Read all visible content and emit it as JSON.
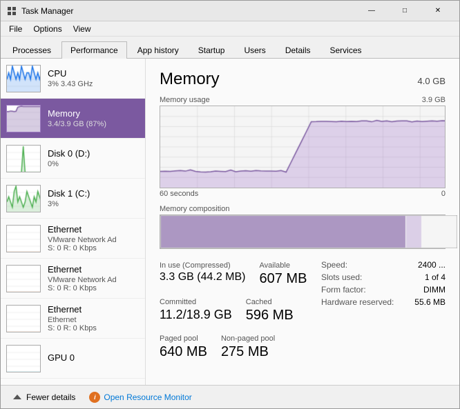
{
  "window": {
    "title": "Task Manager",
    "controls": {
      "minimize": "—",
      "maximize": "□",
      "close": "✕"
    }
  },
  "menu": {
    "items": [
      "File",
      "Options",
      "View"
    ]
  },
  "tabs": {
    "items": [
      "Processes",
      "Performance",
      "App history",
      "Startup",
      "Users",
      "Details",
      "Services"
    ],
    "active": "Performance"
  },
  "sidebar": {
    "items": [
      {
        "name": "CPU",
        "secondary": "3% 3.43 GHz",
        "type": "cpu"
      },
      {
        "name": "Memory",
        "secondary": "3.4/3.9 GB (87%)",
        "type": "memory",
        "selected": true
      },
      {
        "name": "Disk 0 (D:)",
        "secondary": "0%",
        "type": "disk0"
      },
      {
        "name": "Disk 1 (C:)",
        "secondary": "3%",
        "type": "disk1"
      },
      {
        "name": "Ethernet",
        "secondary_line1": "VMware Network Ad",
        "secondary_line2": "S: 0 R: 0 Kbps",
        "type": "eth1"
      },
      {
        "name": "Ethernet",
        "secondary_line1": "VMware Network Ad",
        "secondary_line2": "S: 0 R: 0 Kbps",
        "type": "eth2"
      },
      {
        "name": "Ethernet",
        "secondary_line1": "Ethernet",
        "secondary_line2": "S: 0 R: 0 Kbps",
        "type": "eth3"
      },
      {
        "name": "GPU 0",
        "secondary": "",
        "type": "gpu"
      }
    ],
    "scroll_up_label": "▲",
    "scroll_down_label": "▼"
  },
  "main": {
    "title": "Memory",
    "total": "4.0 GB",
    "chart": {
      "label": "Memory usage",
      "max_label": "3.9 GB",
      "time_start": "60 seconds",
      "time_end": "0",
      "composition_label": "Memory composition"
    },
    "stats": {
      "in_use_label": "In use (Compressed)",
      "in_use_value": "3.3 GB (44.2 MB)",
      "available_label": "Available",
      "available_value": "607 MB",
      "committed_label": "Committed",
      "committed_value": "11.2/18.9 GB",
      "cached_label": "Cached",
      "cached_value": "596 MB",
      "paged_pool_label": "Paged pool",
      "paged_pool_value": "640 MB",
      "non_paged_pool_label": "Non-paged pool",
      "non_paged_pool_value": "275 MB"
    },
    "right_stats": {
      "speed_label": "Speed:",
      "speed_value": "2400 ...",
      "slots_label": "Slots used:",
      "slots_value": "1 of 4",
      "form_label": "Form factor:",
      "form_value": "DIMM",
      "hardware_label": "Hardware reserved:",
      "hardware_value": "55.6 MB"
    }
  },
  "bottom": {
    "fewer_details_label": "Fewer details",
    "open_monitor_label": "Open Resource Monitor"
  }
}
